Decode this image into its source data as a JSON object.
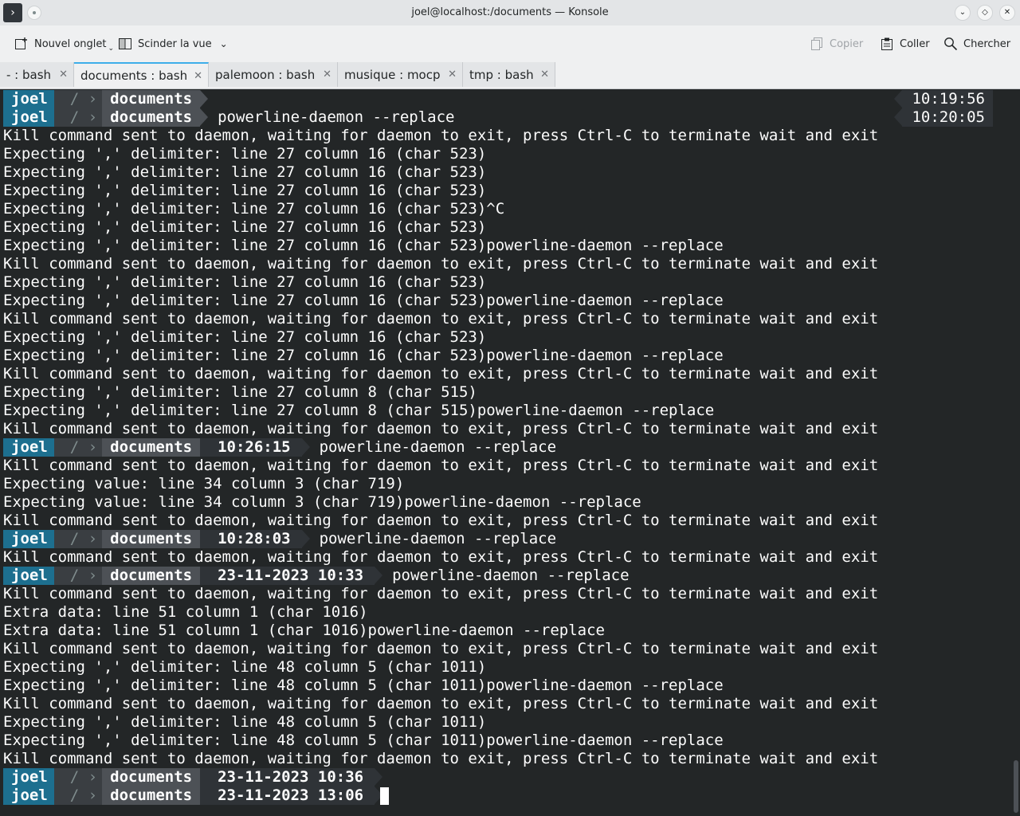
{
  "window": {
    "title": "joel@localhost:/documents — Konsole",
    "app_icon": "terminal-icon"
  },
  "toolbar": {
    "new_tab": "Nouvel onglet",
    "split_view": "Scinder la vue",
    "copy": "Copier",
    "paste": "Coller",
    "search": "Chercher"
  },
  "tabs": [
    {
      "label": "- : bash"
    },
    {
      "label": "documents : bash"
    },
    {
      "label": "palemoon : bash"
    },
    {
      "label": "musique : mocp"
    },
    {
      "label": "tmp : bash"
    }
  ],
  "prompt": {
    "user": "joel",
    "root": "/",
    "sep": "›",
    "dir": "documents"
  },
  "terminal": {
    "p1_rtime": "10:19:56",
    "p2_cmd": "powerline-daemon --replace",
    "p2_rtime": "10:20:05",
    "l1": "Kill command sent to daemon, waiting for daemon to exit, press Ctrl-C to terminate wait and exit",
    "l2": "Expecting ',' delimiter: line 27 column 16 (char 523)",
    "l3": "Expecting ',' delimiter: line 27 column 16 (char 523)",
    "l4": "Expecting ',' delimiter: line 27 column 16 (char 523)",
    "l5": "Expecting ',' delimiter: line 27 column 16 (char 523)^C",
    "l6": "Expecting ',' delimiter: line 27 column 16 (char 523)",
    "l7": "Expecting ',' delimiter: line 27 column 16 (char 523)powerline-daemon --replace",
    "l8": "Kill command sent to daemon, waiting for daemon to exit, press Ctrl-C to terminate wait and exit",
    "l9": "Expecting ',' delimiter: line 27 column 16 (char 523)",
    "l10": "Expecting ',' delimiter: line 27 column 16 (char 523)powerline-daemon --replace",
    "l11": "Kill command sent to daemon, waiting for daemon to exit, press Ctrl-C to terminate wait and exit",
    "l12": "Expecting ',' delimiter: line 27 column 16 (char 523)",
    "l13": "Expecting ',' delimiter: line 27 column 16 (char 523)powerline-daemon --replace",
    "l14": "Kill command sent to daemon, waiting for daemon to exit, press Ctrl-C to terminate wait and exit",
    "l15": "Expecting ',' delimiter: line 27 column 8 (char 515)",
    "l16": "Expecting ',' delimiter: line 27 column 8 (char 515)powerline-daemon --replace",
    "l17": "Kill command sent to daemon, waiting for daemon to exit, press Ctrl-C to terminate wait and exit",
    "p3_time": "10:26:15",
    "p3_cmd": "powerline-daemon --replace",
    "l18": "Kill command sent to daemon, waiting for daemon to exit, press Ctrl-C to terminate wait and exit",
    "l19": "Expecting value: line 34 column 3 (char 719)",
    "l20": "Expecting value: line 34 column 3 (char 719)powerline-daemon --replace",
    "l21": "Kill command sent to daemon, waiting for daemon to exit, press Ctrl-C to terminate wait and exit",
    "p4_time": "10:28:03",
    "p4_cmd": "powerline-daemon --replace",
    "l22": "Kill command sent to daemon, waiting for daemon to exit, press Ctrl-C to terminate wait and exit",
    "p5_time": "23-11-2023 10:33",
    "p5_cmd": "powerline-daemon --replace",
    "l23": "Kill command sent to daemon, waiting for daemon to exit, press Ctrl-C to terminate wait and exit",
    "l24": "Extra data: line 51 column 1 (char 1016)",
    "l25": "Extra data: line 51 column 1 (char 1016)powerline-daemon --replace",
    "l26": "Kill command sent to daemon, waiting for daemon to exit, press Ctrl-C to terminate wait and exit",
    "l27": "Expecting ',' delimiter: line 48 column 5 (char 1011)",
    "l28": "Expecting ',' delimiter: line 48 column 5 (char 1011)powerline-daemon --replace",
    "l29": "Kill command sent to daemon, waiting for daemon to exit, press Ctrl-C to terminate wait and exit",
    "l30": "Expecting ',' delimiter: line 48 column 5 (char 1011)",
    "l31": "Expecting ',' delimiter: line 48 column 5 (char 1011)powerline-daemon --replace",
    "l32": "Kill command sent to daemon, waiting for daemon to exit, press Ctrl-C to terminate wait and exit",
    "p6_time": "23-11-2023 10:36",
    "p7_time": "23-11-2023 13:06"
  },
  "colors": {
    "terminal_bg": "#232627",
    "prompt_user_bg": "#1d6f8f",
    "accent": "#3daee9"
  }
}
